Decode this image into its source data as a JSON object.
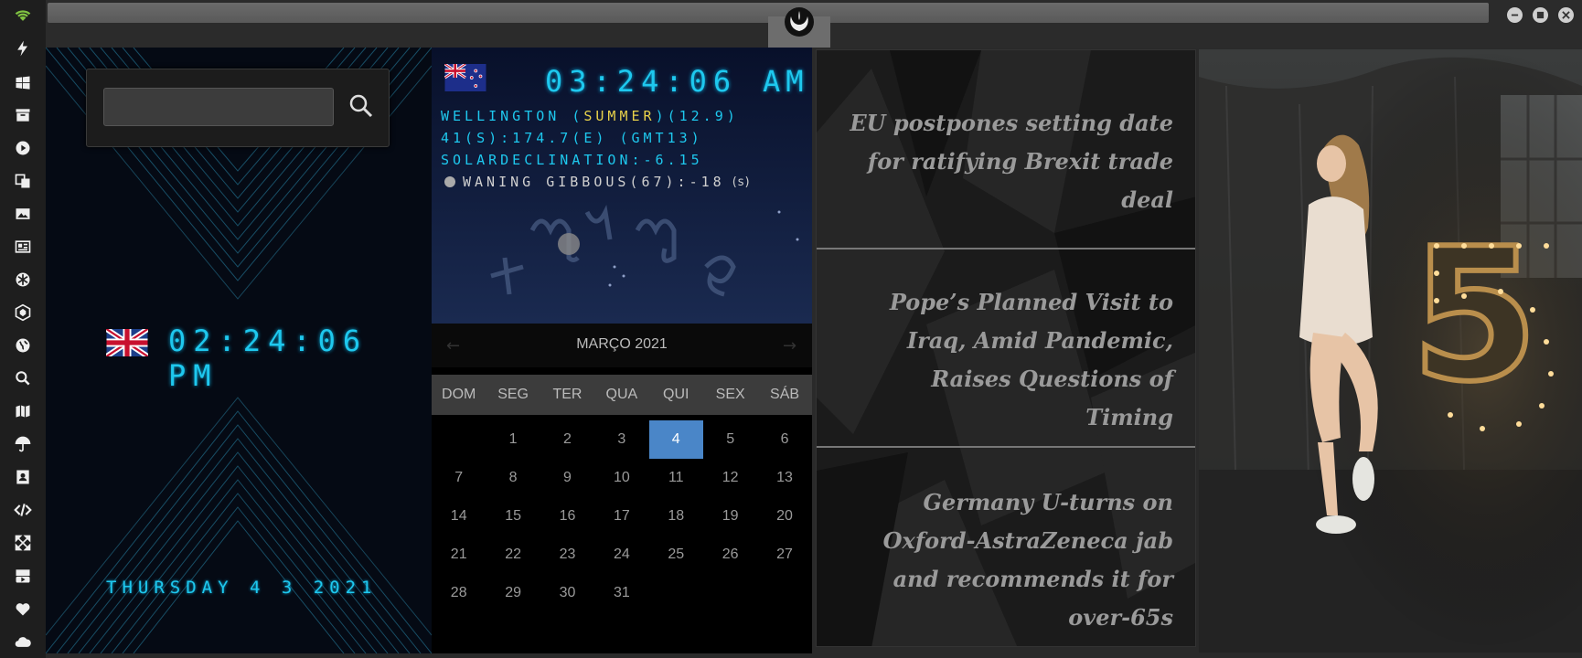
{
  "window": {
    "logo_icon": "rebel-alliance-icon",
    "buttons": [
      "minimize-icon",
      "maximize-icon",
      "close-icon"
    ]
  },
  "sidebar": {
    "items": [
      {
        "icon": "wifi-icon",
        "color": "#7fc241"
      },
      {
        "icon": "lightning-icon"
      },
      {
        "icon": "windows-icon"
      },
      {
        "icon": "archive-icon"
      },
      {
        "icon": "play-icon"
      },
      {
        "icon": "translate-icon"
      },
      {
        "icon": "image-icon"
      },
      {
        "icon": "newspaper-icon"
      },
      {
        "icon": "snowflake-icon"
      },
      {
        "icon": "hexagon-icon"
      },
      {
        "icon": "globe-icon"
      },
      {
        "icon": "search-icon"
      },
      {
        "icon": "map-icon"
      },
      {
        "icon": "umbrella-icon"
      },
      {
        "icon": "contacts-icon"
      },
      {
        "icon": "code-icon"
      },
      {
        "icon": "expand-icon"
      },
      {
        "icon": "youtube-icon"
      },
      {
        "icon": "heart-icon"
      },
      {
        "icon": "cloud-icon"
      }
    ]
  },
  "search": {
    "value": "",
    "placeholder": ""
  },
  "uk_clock": {
    "time": "02:24:06 PM",
    "date": "THURSDAY 4 3 2021",
    "flag": "uk-flag-icon",
    "color": "#1ec8ee"
  },
  "nz_clock": {
    "time": "03:24:06",
    "ampm": "AM",
    "flag": "nz-flag-icon",
    "line1_a": "WELLINGTON (",
    "line1_season": "SUMMER",
    "line1_b": ")(12.9)",
    "line2": "41(S):174.7(E) (GMT13)",
    "line3": "SOLARDECLINATION:-6.15",
    "moon": "WANING GIBBOUS(67):-18",
    "moon_unit": "(s)"
  },
  "calendar": {
    "title": "MARÇO 2021",
    "prev": "←",
    "next": "→",
    "weekdays": [
      "DOM",
      "SEG",
      "TER",
      "QUA",
      "QUI",
      "SEX",
      "SÁB"
    ],
    "weeks": [
      [
        "",
        "1",
        "2",
        "3",
        "4",
        "5",
        "6"
      ],
      [
        "7",
        "8",
        "9",
        "10",
        "11",
        "12",
        "13"
      ],
      [
        "14",
        "15",
        "16",
        "17",
        "18",
        "19",
        "20"
      ],
      [
        "21",
        "22",
        "23",
        "24",
        "25",
        "26",
        "27"
      ],
      [
        "28",
        "29",
        "30",
        "31",
        "",
        "",
        ""
      ]
    ],
    "today": "4",
    "today_color": "#4a86c8"
  },
  "news": [
    {
      "headline": "EU postpones setting date for ratifying Brexit trade deal"
    },
    {
      "headline": "Pope’s Planned Visit to Iraq, Amid Pandemic, Raises Questions of Timing"
    },
    {
      "headline": "Germany U-turns on Oxford-AstraZeneca jab and recommends it for over-65s"
    }
  ],
  "photo": {
    "sign_text": "5"
  }
}
